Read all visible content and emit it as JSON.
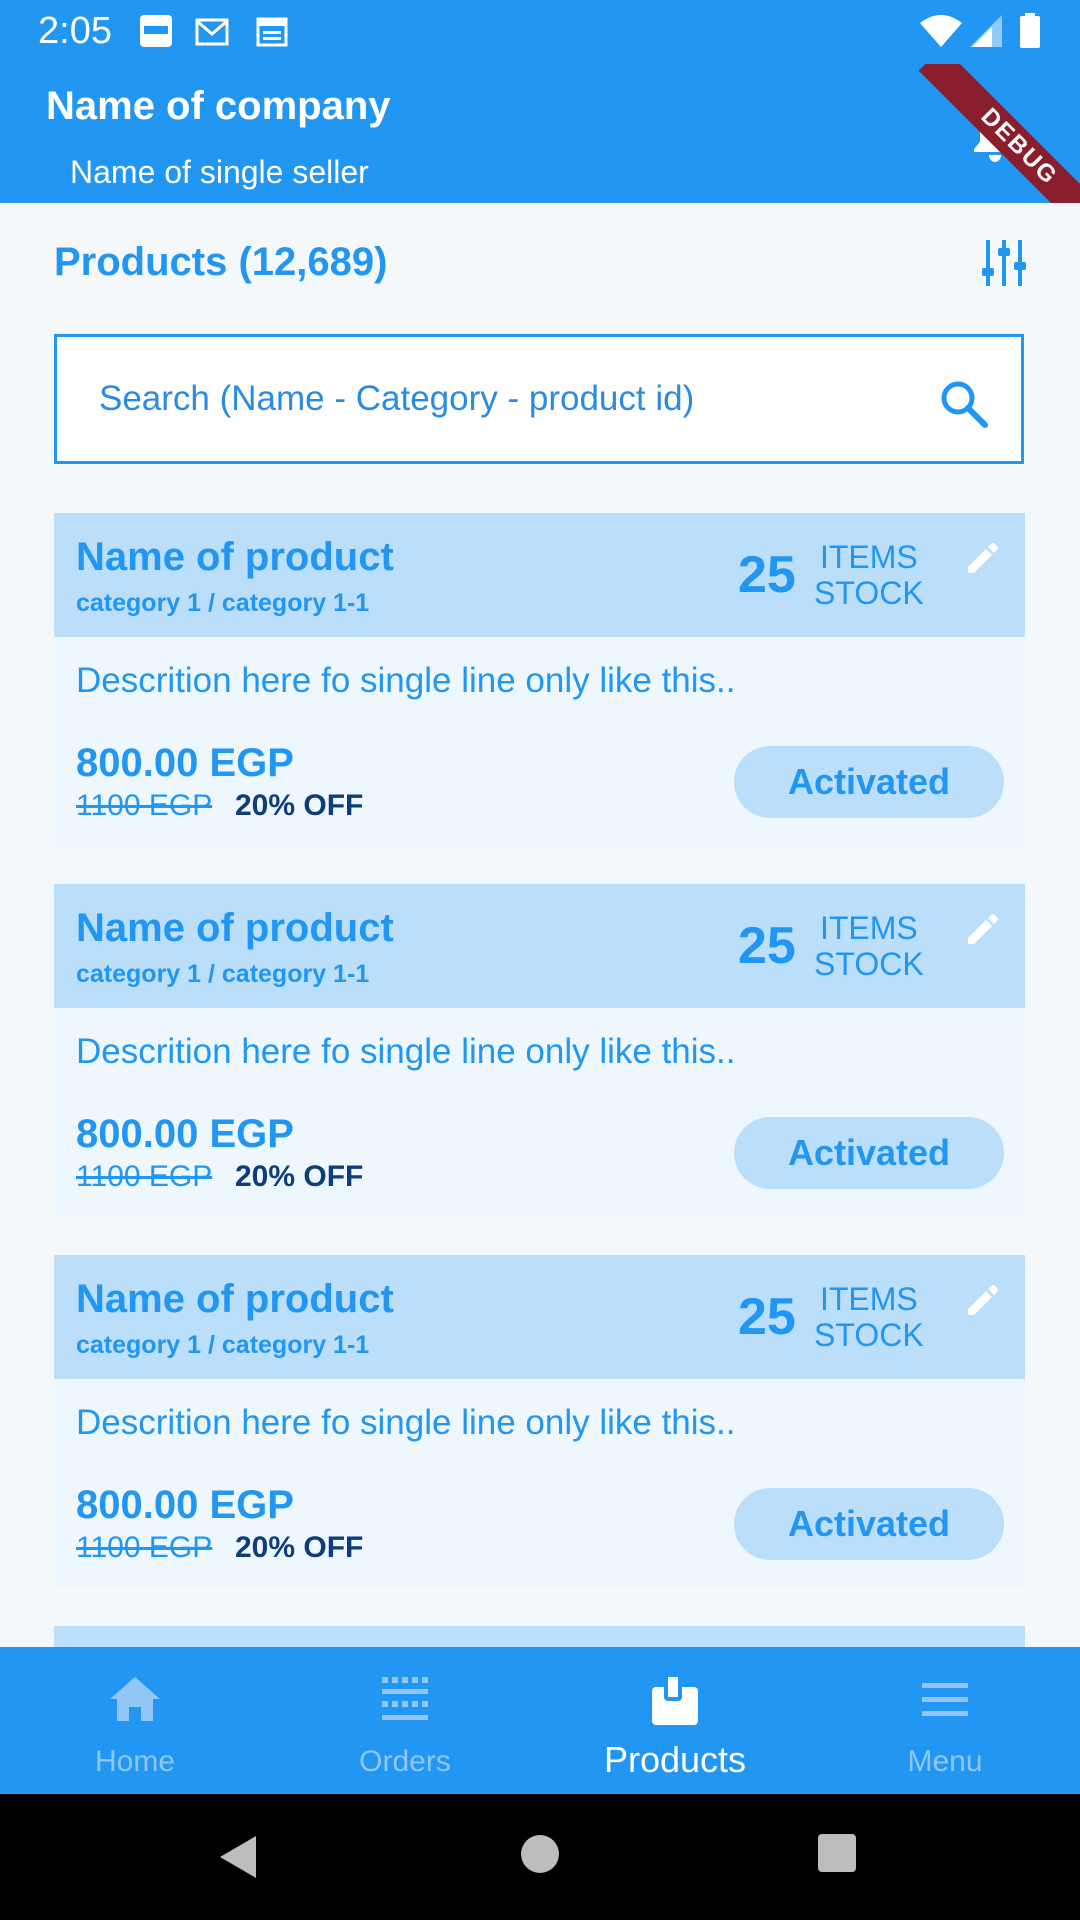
{
  "status_bar": {
    "time": "2:05",
    "debug_label": "DEBUG"
  },
  "app_bar": {
    "company_name": "Name of company",
    "seller_name": "Name of single seller"
  },
  "products": {
    "title": "Products (12,689)"
  },
  "search": {
    "placeholder": "Search (Name - Category - product id)"
  },
  "items": [
    {
      "name": "Name of product",
      "category": "category 1 / category 1-1",
      "stock": "25",
      "stock_label_1": "ITEMS",
      "stock_label_2": "STOCK",
      "description": "Descrition here fo single line only like this..",
      "price": "800.00 EGP",
      "old_price": "1100 EGP",
      "discount": "20% OFF",
      "status": "Activated"
    },
    {
      "name": "Name of product",
      "category": "category 1 / category 1-1",
      "stock": "25",
      "stock_label_1": "ITEMS",
      "stock_label_2": "STOCK",
      "description": "Descrition here fo single line only like this..",
      "price": "800.00 EGP",
      "old_price": "1100 EGP",
      "discount": "20% OFF",
      "status": "Activated"
    },
    {
      "name": "Name of product",
      "category": "category 1 / category 1-1",
      "stock": "25",
      "stock_label_1": "ITEMS",
      "stock_label_2": "STOCK",
      "description": "Descrition here fo single line only like this..",
      "price": "800.00 EGP",
      "old_price": "1100 EGP",
      "discount": "20% OFF",
      "status": "Activated"
    }
  ],
  "bottom_nav": [
    {
      "label": "Home",
      "icon": "home-icon",
      "active": false
    },
    {
      "label": "Orders",
      "icon": "orders-icon",
      "active": false
    },
    {
      "label": "Products",
      "icon": "products-icon",
      "active": true
    },
    {
      "label": "Menu",
      "icon": "menu-icon",
      "active": false
    }
  ],
  "colors": {
    "primary": "#2196f3",
    "card_header": "#bbdefa",
    "card_body": "#eef7fd",
    "discount_text": "#0d3d7a",
    "debug": "#8b1e2c"
  }
}
